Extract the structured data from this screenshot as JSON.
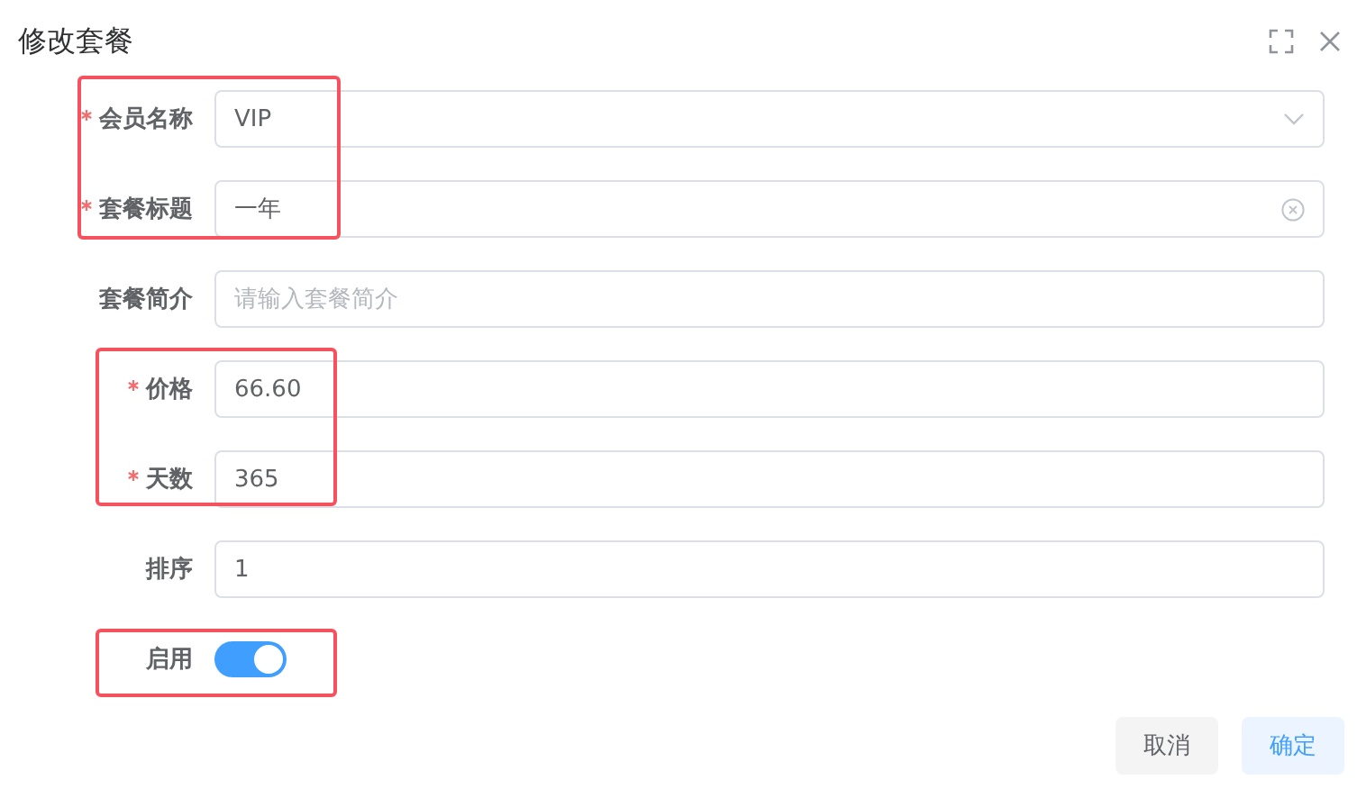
{
  "dialog": {
    "title": "修改套餐"
  },
  "fields": [
    {
      "label": "会员名称",
      "required": true,
      "kind": "select",
      "value": "VIP"
    },
    {
      "label": "套餐标题",
      "required": true,
      "kind": "clearable",
      "value": "一年"
    },
    {
      "label": "套餐简介",
      "required": false,
      "kind": "input",
      "placeholder": "请输入套餐简介"
    },
    {
      "label": "价格",
      "required": true,
      "kind": "input",
      "value": "66.60"
    },
    {
      "label": "天数",
      "required": true,
      "kind": "input",
      "value": "365"
    },
    {
      "label": "排序",
      "required": false,
      "kind": "input",
      "value": "1"
    },
    {
      "label": "启用",
      "required": false,
      "kind": "switch",
      "on": true
    }
  ],
  "buttons": [
    {
      "label": "取消",
      "kind": "secondary"
    },
    {
      "label": "确定",
      "kind": "primary"
    }
  ]
}
